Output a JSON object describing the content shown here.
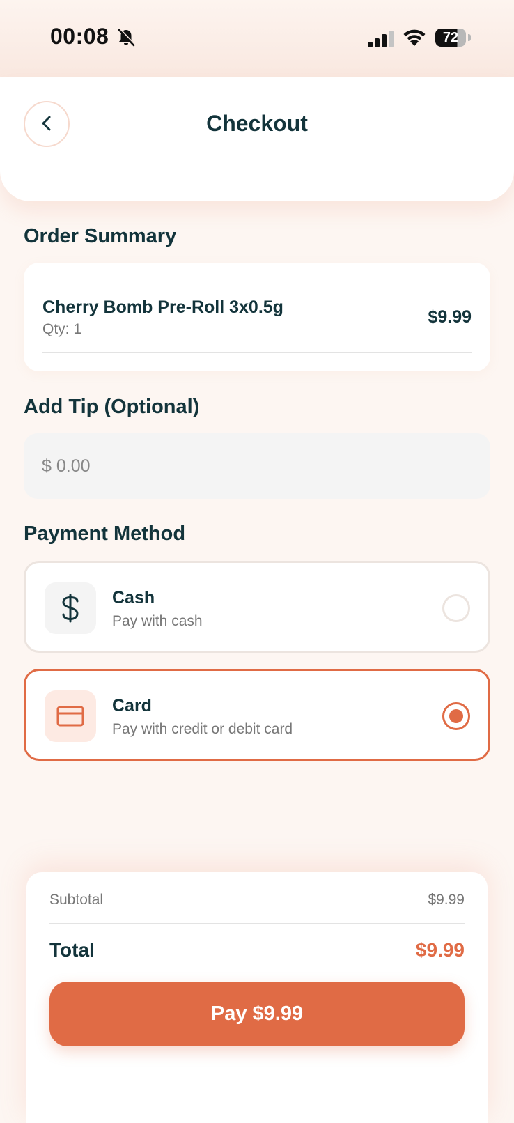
{
  "status_bar": {
    "time": "00:08",
    "battery": "72"
  },
  "header": {
    "title": "Checkout"
  },
  "order_summary": {
    "label": "Order Summary",
    "items": [
      {
        "name": "Cherry Bomb Pre-Roll 3x0.5g",
        "qty": "Qty: 1",
        "price": "$9.99"
      }
    ]
  },
  "tip": {
    "label": "Add Tip (Optional)",
    "placeholder": "$ 0.00"
  },
  "payment": {
    "label": "Payment Method",
    "options": [
      {
        "name": "Cash",
        "description": "Pay with cash",
        "selected": false
      },
      {
        "name": "Card",
        "description": "Pay with credit or debit card",
        "selected": true
      }
    ]
  },
  "summary": {
    "subtotal_label": "Subtotal",
    "subtotal_value": "$9.99",
    "total_label": "Total",
    "total_value": "$9.99",
    "pay_button": "Pay $9.99"
  },
  "colors": {
    "accent": "#e06b45",
    "text": "#13343b",
    "background": "#fdf6f2"
  }
}
